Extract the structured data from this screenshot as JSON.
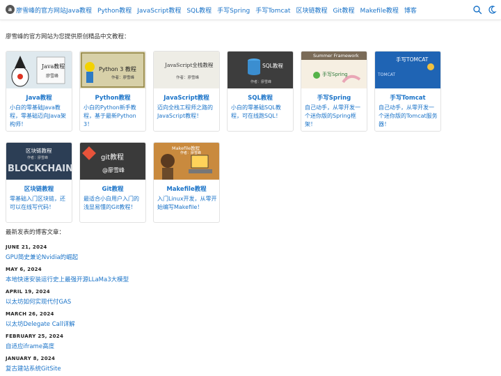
{
  "nav": {
    "site_name": "廖雪峰的官方网站",
    "links": [
      "Java教程",
      "Python教程",
      "JavaScript教程",
      "SQL教程",
      "手写Spring",
      "手写Tomcat",
      "区块链教程",
      "Git教程",
      "Makefile教程",
      "博客"
    ],
    "icons": [
      "search-icon",
      "moon-icon"
    ]
  },
  "intro": "廖雪峰的官方网站为您提供原创精品中文教程：",
  "courses": [
    {
      "title": "Java教程",
      "desc": "小白的零基础Java教程，零基础迈向Java架构师！",
      "thumb": {
        "line1": "Java教程",
        "line2": "廖雪峰"
      }
    },
    {
      "title": "Python教程",
      "desc": "小白的Python新手教程，基于最新Python 3！",
      "thumb": {
        "line1": "Python 3 教程",
        "line2": "作者：廖雪峰"
      }
    },
    {
      "title": "JavaScript教程",
      "desc": "迈向全栈工程师之路的JavaScript教程！",
      "thumb": {
        "line1": "JavaScript全栈教程",
        "line2": "作者：廖雪峰"
      }
    },
    {
      "title": "SQL教程",
      "desc": "小白的零基础SQL教程，可在线跑SQL！",
      "thumb": {
        "line1": "SQL教程",
        "line2": "作者：廖雪峰"
      }
    },
    {
      "title": "手写Spring",
      "desc": "自己动手，从零开发一个迷你版的Spring框架！",
      "thumb": {
        "line1": "Summer Framework",
        "line2": "手写Spring"
      }
    },
    {
      "title": "手写Tomcat",
      "desc": "自己动手，从零开发一个迷你版的Tomcat服务器！",
      "thumb": {
        "line1": "手写TOMCAT",
        "line2": "TOMCAT"
      }
    },
    {
      "title": "区块链教程",
      "desc": "零基础入门区块链，还可以在线写代码！",
      "thumb": {
        "line1": "区块链教程",
        "line2": "作者：廖雪峰",
        "line3": "BLOCKCHAIN"
      }
    },
    {
      "title": "Git教程",
      "desc": "最适合小白用户入门的浅显易懂的Git教程！",
      "thumb": {
        "line1": "git教程",
        "line2": "@廖雪峰"
      }
    },
    {
      "title": "Makefile教程",
      "desc": "入门Linux开发，从零开始编写Makefile！",
      "thumb": {
        "line1": "Makefile教程",
        "line2": "作者：廖雪峰"
      }
    }
  ],
  "blog": {
    "heading": "最新发表的博客文章：",
    "posts": [
      {
        "date": "JUNE 21, 2024",
        "title": "GPU简史兼论Nvidia的崛起"
      },
      {
        "date": "MAY 6, 2024",
        "title": "本地快速安装运行史上最强开源LLaMa3大模型"
      },
      {
        "date": "APRIL 19, 2024",
        "title": "以太坊如何实现代付GAS"
      },
      {
        "date": "MARCH 26, 2024",
        "title": "以太坊Delegate Call详解"
      },
      {
        "date": "FEBRUARY 25, 2024",
        "title": "自适应iframe高度"
      },
      {
        "date": "JANUARY 8, 2024",
        "title": "复古建站系统GitSite"
      }
    ]
  },
  "colors": {
    "link": "#1a73c8",
    "text": "#333333",
    "border": "#e2e2e2"
  }
}
